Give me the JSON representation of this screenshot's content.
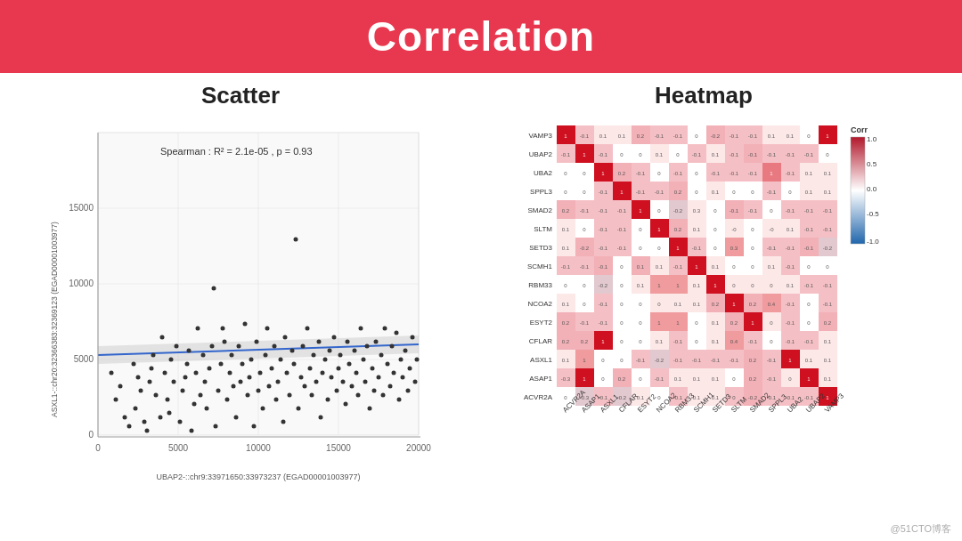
{
  "header": {
    "title": "Correlation",
    "bg_color": "#e8384f"
  },
  "scatter": {
    "title": "Scatter",
    "annotation": "Spearman : R² = 2.1e-05 , p = 0.93",
    "x_label": "UBAP2-::chr9:33971650:33973237 (EGAD00001003977)",
    "y_label": "ASXL1-::chr20:32366383:32369123 (EGAD00001003977)"
  },
  "heatmap": {
    "title": "Heatmap",
    "genes": [
      "VAMP3",
      "UBAP2",
      "UBA2",
      "SPPL3",
      "SMAD2",
      "SLTM",
      "SETD3",
      "SCMH1",
      "RBM33",
      "NCOA2",
      "ESYT2",
      "CFLAR",
      "ASXL1",
      "ASAP1",
      "ACVR2A"
    ],
    "corr_label": "Corr",
    "corr_max": "1.0",
    "corr_mid1": "0.5",
    "corr_mid2": "0.0",
    "corr_mid3": "-0.5",
    "corr_min": "-1.0"
  },
  "watermark": "@51CTO博客"
}
